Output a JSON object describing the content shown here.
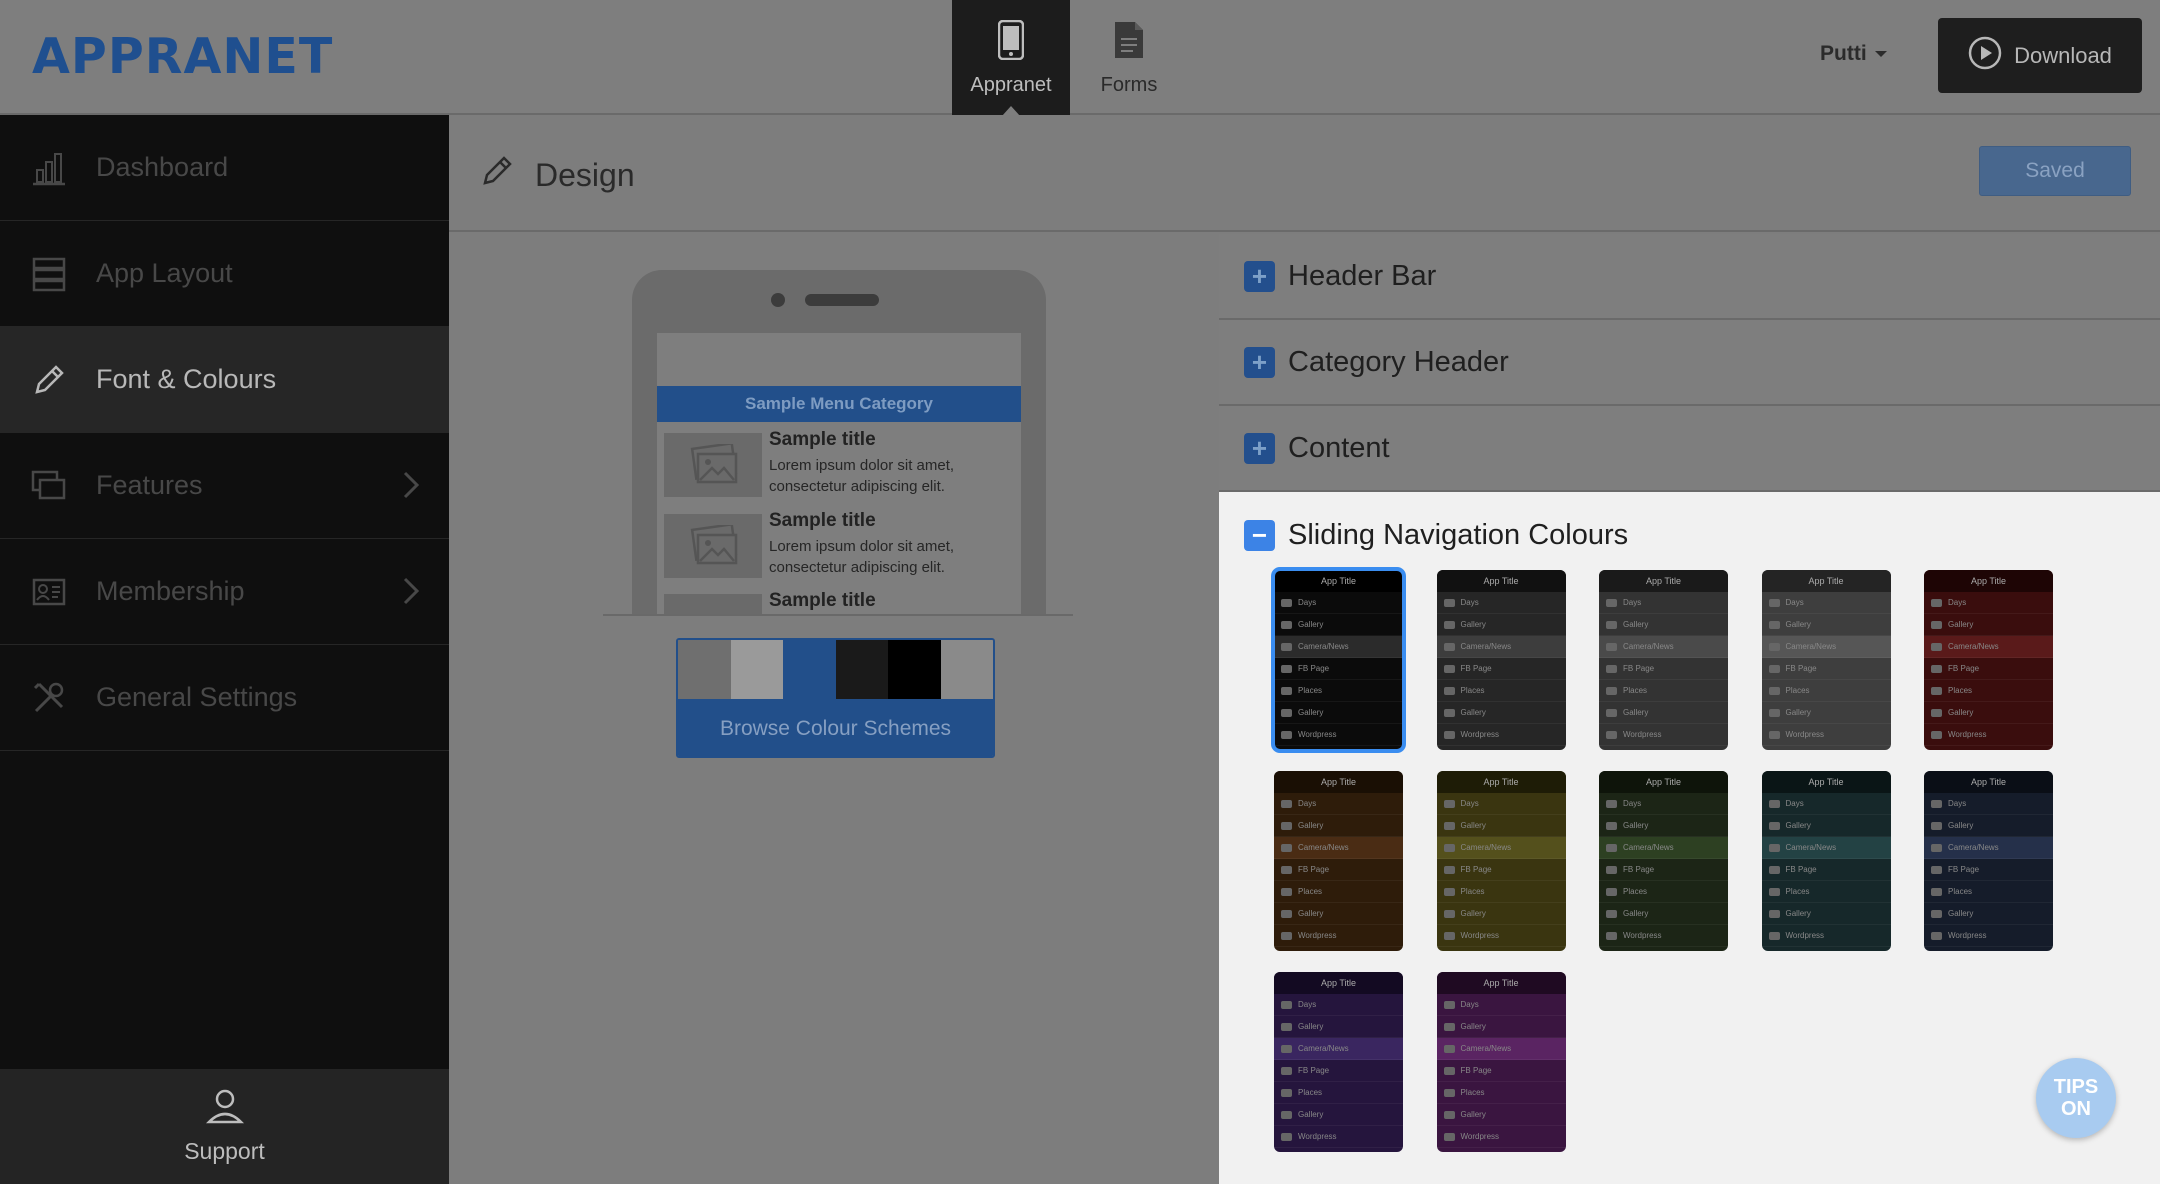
{
  "brand": {
    "logo": "APPRANET"
  },
  "topnav": {
    "items": [
      {
        "label": "Appranet",
        "icon": "phone-icon",
        "active": true
      },
      {
        "label": "Forms",
        "icon": "document-icon",
        "active": false
      }
    ],
    "user": "Putti",
    "download_label": "Download"
  },
  "sidebar": {
    "items": [
      {
        "label": "Dashboard",
        "icon": "chart-icon"
      },
      {
        "label": "App Layout",
        "icon": "layout-icon"
      },
      {
        "label": "Font & Colours",
        "icon": "pencil-icon",
        "active": true
      },
      {
        "label": "Features",
        "icon": "screens-icon",
        "has_submenu": true
      },
      {
        "label": "Membership",
        "icon": "id-card-icon",
        "has_submenu": true
      },
      {
        "label": "General Settings",
        "icon": "tools-icon"
      }
    ],
    "support_label": "Support"
  },
  "main": {
    "title": "Design",
    "saved_label": "Saved",
    "preview": {
      "category": "Sample Menu Category",
      "rows": [
        {
          "title": "Sample title",
          "desc": "Lorem ipsum dolor sit amet, consectetur adipiscing elit."
        },
        {
          "title": "Sample title",
          "desc": "Lorem ipsum dolor sit amet, consectetur adipiscing elit."
        },
        {
          "title": "Sample title",
          "desc": ""
        }
      ]
    },
    "scheme": {
      "swatches": [
        "#6f6f6f",
        "#9a9a9a",
        "#224f8a",
        "#1a1a1a",
        "#000000",
        "#8a8a8a"
      ],
      "label": "Browse Colour Schemes"
    },
    "accordion": {
      "sections": [
        {
          "label": "Header Bar"
        },
        {
          "label": "Category Header"
        },
        {
          "label": "Content"
        }
      ],
      "open_section": "Sliding Navigation Colours",
      "thumb": {
        "header": "App Title",
        "items": [
          "Days",
          "Gallery",
          "Camera/News",
          "FB Page",
          "Places",
          "Gallery",
          "Wordpress"
        ]
      },
      "themes": [
        {
          "bg": "#0b0b0b",
          "hdr": "#000000",
          "hl": "#2b2b2b",
          "selected": true
        },
        {
          "bg": "#262626",
          "hdr": "#111111",
          "hl": "#3d3d3d"
        },
        {
          "bg": "#333333",
          "hdr": "#1a1a1a",
          "hl": "#4a4a4a"
        },
        {
          "bg": "#3e3e3e",
          "hdr": "#242424",
          "hl": "#565656"
        },
        {
          "bg": "#3a0d0d",
          "hdr": "#1e0505",
          "hl": "#5a1a1a"
        },
        {
          "bg": "#2e1c0a",
          "hdr": "#1a0f04",
          "hl": "#4a2c14"
        },
        {
          "bg": "#3a3510",
          "hdr": "#1e1c06",
          "hl": "#54501c"
        },
        {
          "bg": "#1c2516",
          "hdr": "#0e140a",
          "hl": "#2d4022"
        },
        {
          "bg": "#16282a",
          "hdr": "#0a1516",
          "hl": "#234244"
        },
        {
          "bg": "#151c2a",
          "hdr": "#0a0e16",
          "hl": "#25304a"
        },
        {
          "bg": "#25153d",
          "hdr": "#130a22",
          "hl": "#3a2660"
        },
        {
          "bg": "#3a1540",
          "hdr": "#1f0a22",
          "hl": "#5a2462"
        }
      ]
    },
    "tips": {
      "line1": "TIPS",
      "line2": "ON"
    }
  }
}
